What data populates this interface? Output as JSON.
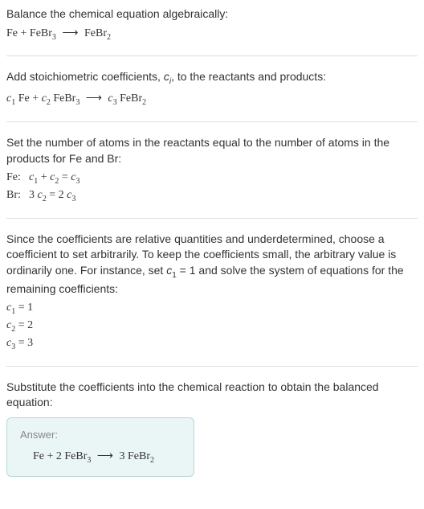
{
  "section1": {
    "heading": "Balance the chemical equation algebraically:",
    "eq_lhs1": "Fe",
    "eq_plus": " + ",
    "eq_lhs2": "FeBr",
    "eq_lhs2_sub": "3",
    "arrow": "⟶",
    "eq_rhs": "FeBr",
    "eq_rhs_sub": "2"
  },
  "section2": {
    "heading_a": "Add stoichiometric coefficients, ",
    "heading_ci": "c",
    "heading_ci_sub": "i",
    "heading_b": ", to the reactants and products:",
    "c1": "c",
    "c1_sub": "1",
    "t1": " Fe + ",
    "c2": "c",
    "c2_sub": "2",
    "t2": " FeBr",
    "t2_sub": "3",
    "arrow": "⟶",
    "c3": "c",
    "c3_sub": "3",
    "t3": " FeBr",
    "t3_sub": "2"
  },
  "section3": {
    "heading": "Set the number of atoms in the reactants equal to the number of atoms in the products for Fe and Br:",
    "fe_label": "Fe:",
    "fe_c1": "c",
    "fe_c1_sub": "1",
    "fe_plus": " + ",
    "fe_c2": "c",
    "fe_c2_sub": "2",
    "fe_eq": " = ",
    "fe_c3": "c",
    "fe_c3_sub": "3",
    "br_label": "Br:",
    "br_3": "3 ",
    "br_c2": "c",
    "br_c2_sub": "2",
    "br_eq": " = 2 ",
    "br_c3": "c",
    "br_c3_sub": "3"
  },
  "section4": {
    "text_a": "Since the coefficients are relative quantities and underdetermined, choose a coefficient to set arbitrarily. To keep the coefficients small, the arbitrary value is ordinarily one. For instance, set ",
    "c1": "c",
    "c1_sub": "1",
    "text_b": " = 1 and solve the system of equations for the remaining coefficients:",
    "r1_c": "c",
    "r1_sub": "1",
    "r1_val": " = 1",
    "r2_c": "c",
    "r2_sub": "2",
    "r2_val": " = 2",
    "r3_c": "c",
    "r3_sub": "3",
    "r3_val": " = 3"
  },
  "section5": {
    "heading": "Substitute the coefficients into the chemical reaction to obtain the balanced equation:",
    "answer_label": "Answer:",
    "eq_1": "Fe + 2 FeBr",
    "eq_1_sub": "3",
    "arrow": "⟶",
    "eq_2": "3 FeBr",
    "eq_2_sub": "2"
  }
}
